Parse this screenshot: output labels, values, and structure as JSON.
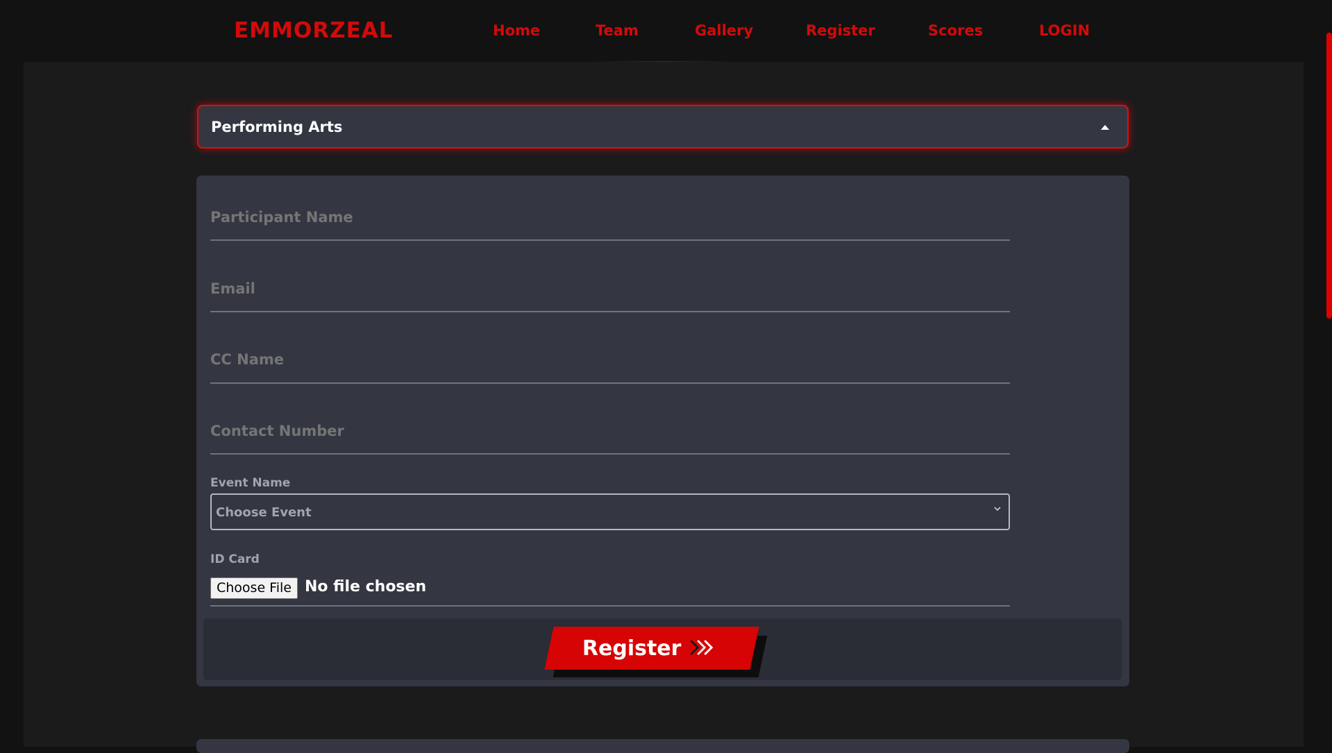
{
  "brand": "EMMORZEAL",
  "nav": {
    "items": [
      "Home",
      "Team",
      "Gallery",
      "Register",
      "Scores",
      "LOGIN"
    ]
  },
  "accordion": {
    "title": "Performing Arts",
    "state": "expanded"
  },
  "form": {
    "participant_name": {
      "placeholder": "Participant Name",
      "value": ""
    },
    "email": {
      "placeholder": "Email",
      "value": ""
    },
    "cc_name": {
      "placeholder": "CC Name",
      "value": ""
    },
    "contact_number": {
      "placeholder": "Contact Number",
      "value": ""
    },
    "event": {
      "label": "Event Name",
      "selected": "Choose Event"
    },
    "id_card": {
      "label": "ID Card",
      "button": "Choose File",
      "status": "No file chosen"
    },
    "submit_label": "Register"
  },
  "icons": {
    "accordion_toggle": "caret-up-icon",
    "select_toggle": "chevron-down-icon",
    "submit": "double-chevron-right-icon"
  },
  "colors": {
    "accent": "#d30a0a",
    "background": "#121212",
    "panel": "#343742",
    "text": "#ffffff"
  }
}
